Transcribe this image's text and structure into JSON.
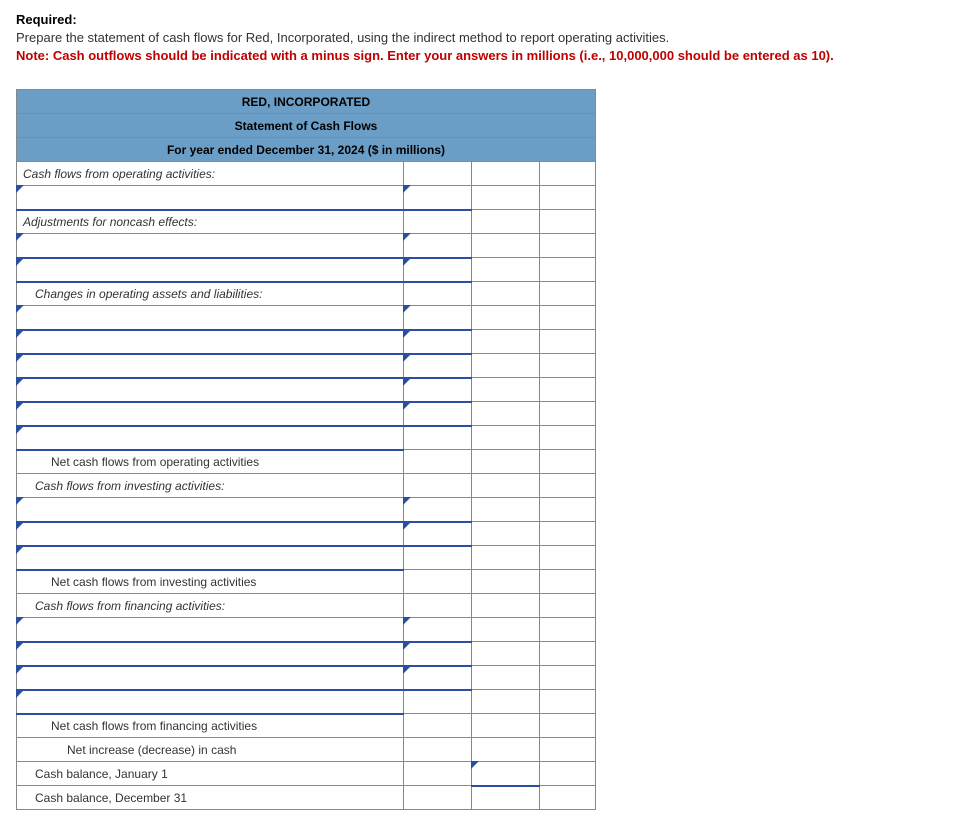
{
  "header": {
    "required_label": "Required:",
    "instruction": "Prepare the statement of cash flows for Red, Incorporated, using the indirect method to report operating activities.",
    "note": "Note: Cash outflows should be indicated with a minus sign. Enter your answers in millions (i.e., 10,000,000 should be entered as 10)."
  },
  "table": {
    "company": "RED, INCORPORATED",
    "title": "Statement of Cash Flows",
    "period": "For year ended December 31, 2024 ($ in millions)",
    "sections": {
      "operating_header": "Cash flows from operating activities:",
      "adjustments_header": "Adjustments for noncash effects:",
      "changes_header": "Changes in operating assets and liabilities:",
      "net_operating": "Net cash flows from operating activities",
      "investing_header": "Cash flows from investing activities:",
      "net_investing": "Net cash flows from investing activities",
      "financing_header": "Cash flows from financing activities:",
      "net_financing": "Net cash flows from financing activities",
      "net_change": "Net increase (decrease) in cash",
      "balance_begin": "Cash balance, January 1",
      "balance_end": "Cash balance, December 31"
    }
  }
}
